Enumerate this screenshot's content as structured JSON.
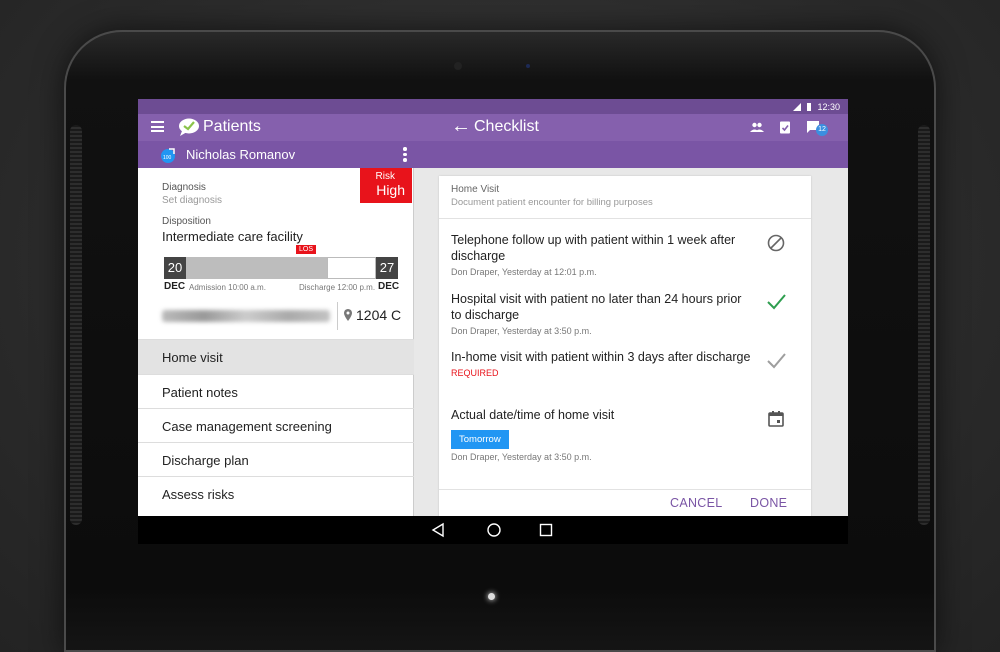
{
  "status_bar": {
    "time": "12:30"
  },
  "toolbar": {
    "app_title": "Patients",
    "page_title": "Checklist",
    "notification_count": "12"
  },
  "patient": {
    "name": "Nicholas Romanov",
    "avatar_number": "100"
  },
  "summary": {
    "diagnosis_label": "Diagnosis",
    "diagnosis_value": "Set diagnosis",
    "risk_label": "Risk",
    "risk_value": "High",
    "disposition_label": "Disposition",
    "disposition_value": "Intermediate care facility",
    "timeline": {
      "admission_day": "20",
      "admission_month": "DEC",
      "admission_note": "Admission 10:00 a.m.",
      "discharge_day": "27",
      "discharge_month": "DEC",
      "discharge_note": "Discharge 12:00 p.m.",
      "los_label": "LOS",
      "progress": 0.74
    },
    "room": "1204 C"
  },
  "nav_items": [
    {
      "label": "Home visit",
      "active": true
    },
    {
      "label": "Patient notes",
      "active": false
    },
    {
      "label": "Case management screening",
      "active": false
    },
    {
      "label": "Discharge plan",
      "active": false
    },
    {
      "label": "Assess risks",
      "active": false
    }
  ],
  "checklist": {
    "title": "Home Visit",
    "subtitle": "Document patient encounter for billing purposes",
    "tasks": [
      {
        "text": "Telephone follow up with patient within 1 week after discharge",
        "meta": "Don Draper, Yesterday at 12:01 p.m.",
        "status_icon": "not-applicable-icon"
      },
      {
        "text": "Hospital visit with patient no later than 24 hours prior to discharge",
        "meta": "Don Draper, Yesterday at 3:50 p.m.",
        "status_icon": "check-icon"
      },
      {
        "text": "In-home visit with patient within 3 days after discharge",
        "required": "REQUIRED",
        "status_icon": "check-icon"
      },
      {
        "text": "Actual date/time of home visit",
        "button": "Tomorrow",
        "meta": "Don Draper, Yesterday at 3:50 p.m.",
        "status_icon": "calendar-icon"
      }
    ],
    "cancel_label": "CANCEL",
    "done_label": "DONE"
  },
  "colors": {
    "primary": "#8560ad",
    "status_bar": "#6d4c93",
    "risk": "#e8131b",
    "accent_blue": "#2196f3",
    "check_green": "#2e9e4f"
  }
}
